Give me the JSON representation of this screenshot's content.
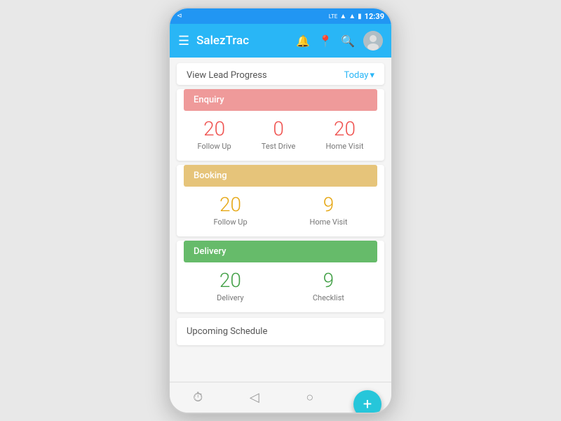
{
  "statusBar": {
    "time": "12:39",
    "network": "LTE"
  },
  "header": {
    "menuIcon": "☰",
    "title": "SalezTrac",
    "bellIcon": "🔔",
    "locationIcon": "📍",
    "searchIcon": "🔍"
  },
  "leadProgress": {
    "viewLabel": "View Lead Progress",
    "todayLabel": "Today",
    "chevron": "▾"
  },
  "enquiry": {
    "sectionLabel": "Enquiry",
    "stats": [
      {
        "value": "20",
        "label": "Follow Up"
      },
      {
        "value": "0",
        "label": "Test Drive"
      },
      {
        "value": "20",
        "label": "Home Visit"
      }
    ]
  },
  "booking": {
    "sectionLabel": "Booking",
    "stats": [
      {
        "value": "20",
        "label": "Follow Up"
      },
      {
        "value": "9",
        "label": "Home Visit"
      }
    ]
  },
  "delivery": {
    "sectionLabel": "Delivery",
    "stats": [
      {
        "value": "20",
        "label": "Delivery"
      },
      {
        "value": "9",
        "label": "Checklist"
      }
    ]
  },
  "upcoming": {
    "label": "Upcoming Schedule"
  },
  "fab": {
    "icon": "+"
  },
  "bottomNav": {
    "icons": [
      "⏱",
      "◁",
      "○",
      "□"
    ]
  }
}
